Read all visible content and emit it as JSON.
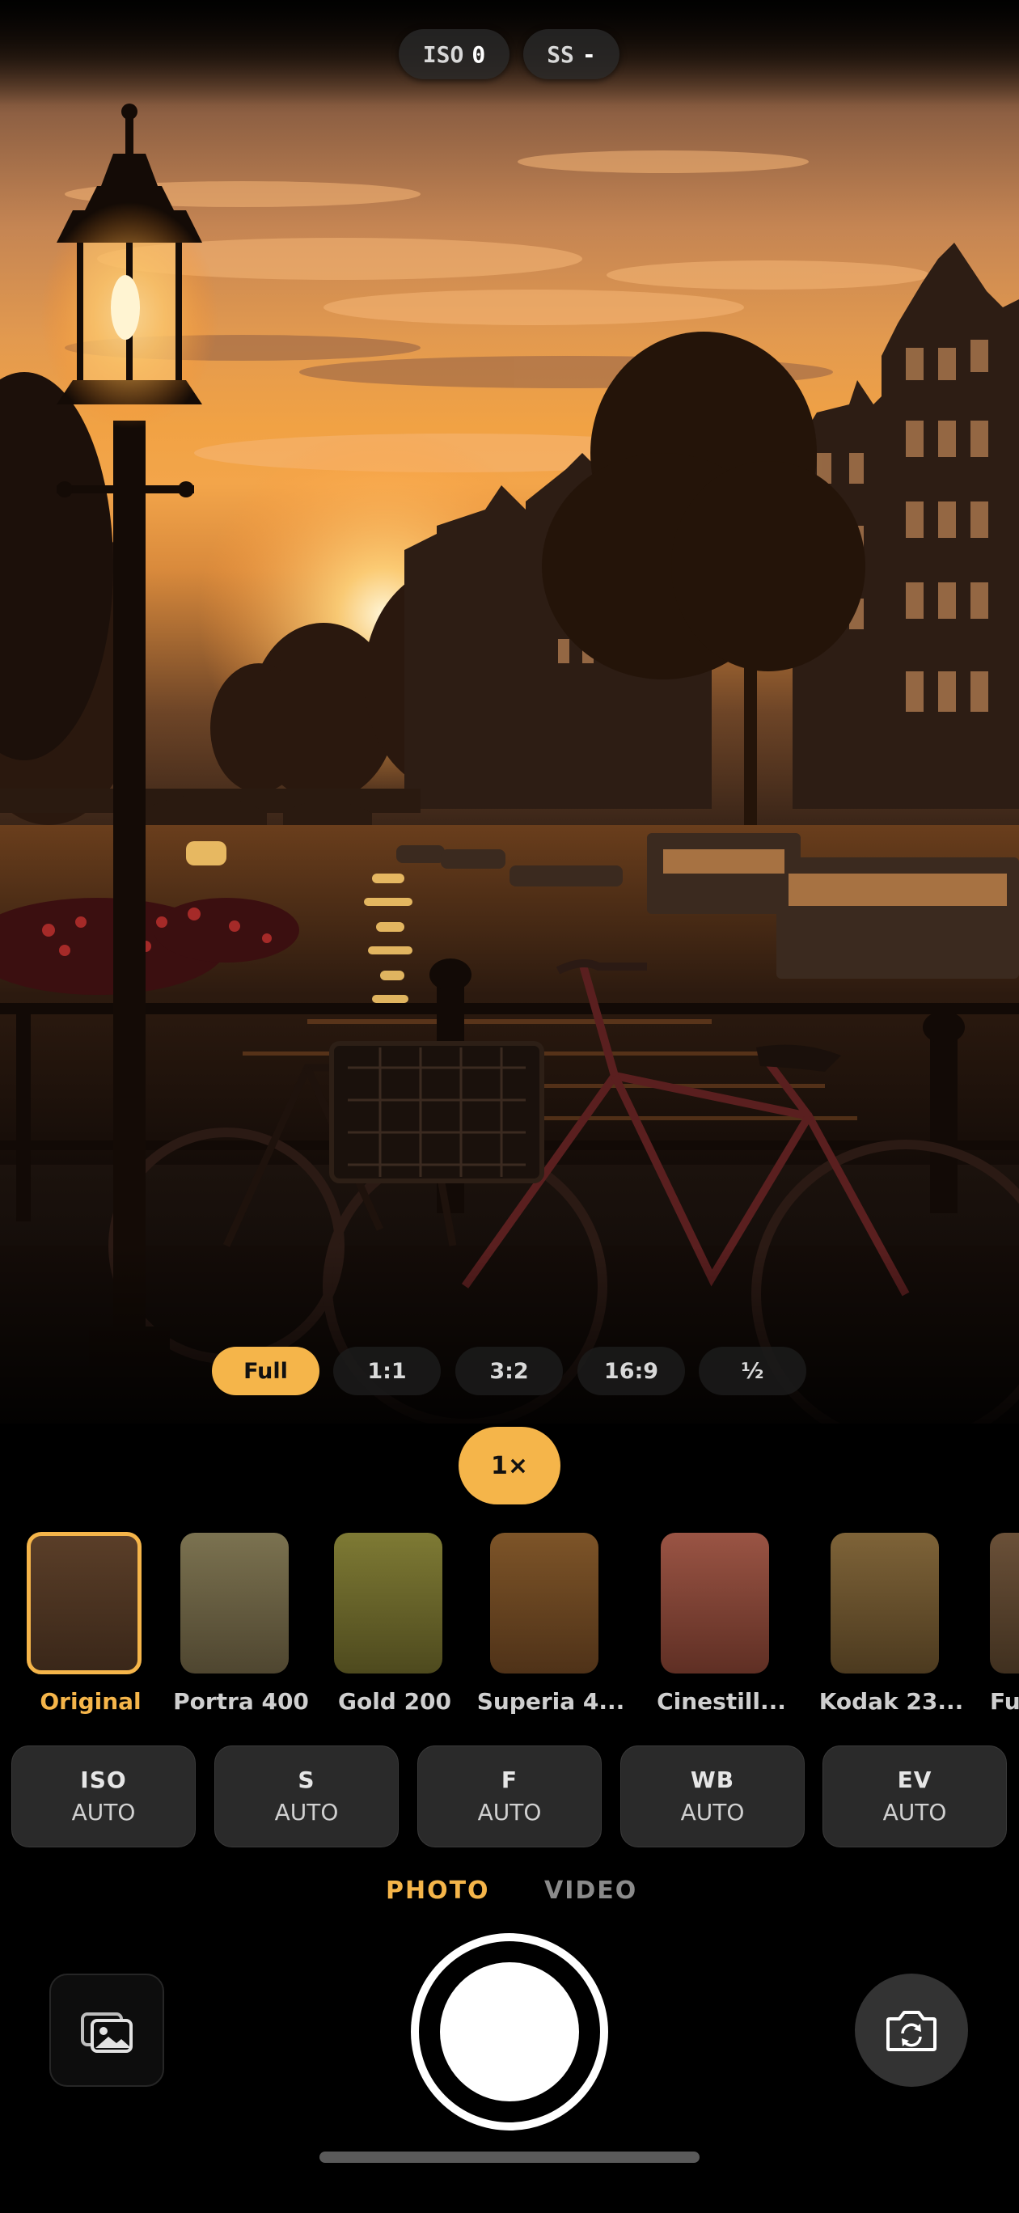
{
  "top_indicators": {
    "iso_label": "ISO",
    "iso_value": "0",
    "ss_label": "SS",
    "ss_value": "-"
  },
  "aspect_ratios": [
    {
      "label": "Full",
      "active": true
    },
    {
      "label": "1:1",
      "active": false
    },
    {
      "label": "3:2",
      "active": false
    },
    {
      "label": "16:9",
      "active": false
    },
    {
      "label": "½",
      "active": false
    }
  ],
  "zoom": {
    "label": "1×"
  },
  "film_presets": [
    {
      "label": "Original",
      "color": "#4a3322",
      "selected": true
    },
    {
      "label": "Portra 400",
      "color": "#6b6245"
    },
    {
      "label": "Gold 200",
      "color": "#6f6a2c"
    },
    {
      "label": "Superia 4...",
      "color": "#6e4a24"
    },
    {
      "label": "Cinestill...",
      "color": "#8c4b3a"
    },
    {
      "label": "Kodak 23...",
      "color": "#6e5530"
    },
    {
      "label": "Fuj",
      "color": "#5e4630"
    }
  ],
  "manual_controls": [
    {
      "label": "ISO",
      "value": "AUTO"
    },
    {
      "label": "S",
      "value": "AUTO"
    },
    {
      "label": "F",
      "value": "AUTO"
    },
    {
      "label": "WB",
      "value": "AUTO"
    },
    {
      "label": "EV",
      "value": "AUTO"
    }
  ],
  "modes": {
    "photo": "PHOTO",
    "video": "VIDEO",
    "active": "photo"
  },
  "icons": {
    "gallery": "photo-gallery-icon",
    "flip": "camera-flip-icon"
  },
  "colors": {
    "accent": "#f5b54a",
    "background": "#000000"
  }
}
